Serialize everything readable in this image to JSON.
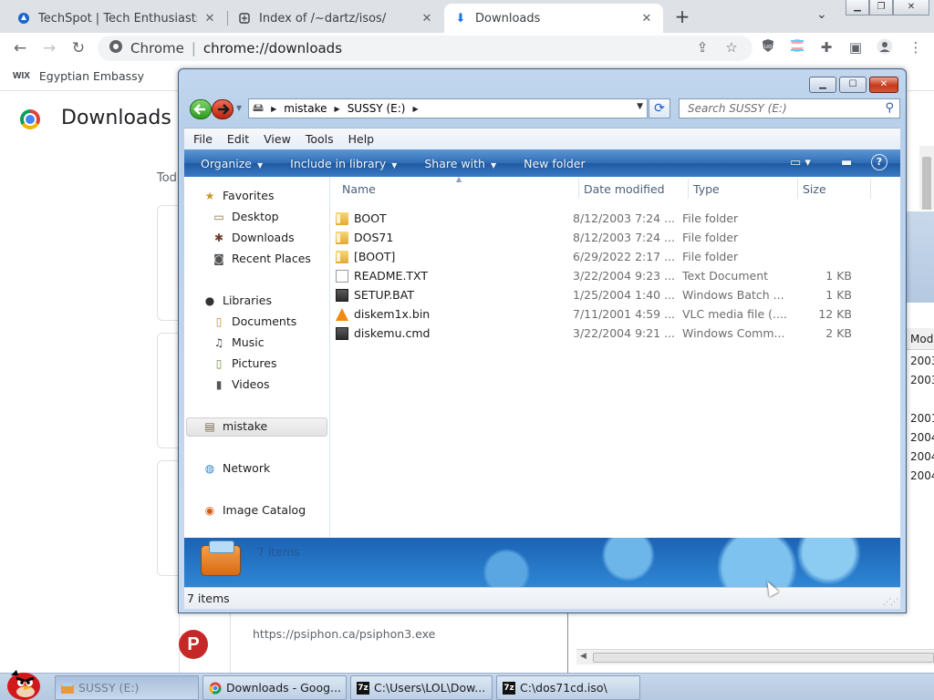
{
  "browser": {
    "tabs": [
      {
        "title": "TechSpot | Tech Enthusiasts, Po",
        "icon": "techspot-icon"
      },
      {
        "title": "Index of /~dartz/isos/",
        "icon": "globe-icon"
      },
      {
        "title": "Downloads",
        "icon": "download-icon",
        "active": true
      }
    ],
    "omnibox": {
      "site": "Chrome",
      "url": "chrome://downloads"
    },
    "bookmarks": [
      {
        "logo": "WIX",
        "label": "Egyptian Embassy"
      }
    ]
  },
  "downloads_page": {
    "title": "Downloads",
    "today_label": "Tod",
    "psiphon_url": "https://psiphon.ca/psiphon3.exe",
    "psiphon_letter": "P"
  },
  "background_window": {
    "column_header": "Mod",
    "values": [
      "2003",
      "2003",
      "2001",
      "2004",
      "2004",
      "2004"
    ]
  },
  "explorer": {
    "breadcrumb": [
      "mistake",
      "SUSSY (E:)"
    ],
    "search_placeholder": "Search SUSSY (E:)",
    "menu": [
      "File",
      "Edit",
      "View",
      "Tools",
      "Help"
    ],
    "commands": [
      {
        "label": "Organize",
        "has_dropdown": true
      },
      {
        "label": "Include in library",
        "has_dropdown": true
      },
      {
        "label": "Share with",
        "has_dropdown": true
      },
      {
        "label": "New folder",
        "has_dropdown": false
      }
    ],
    "nav": {
      "favorites_header": "Favorites",
      "favorites": [
        "Desktop",
        "Downloads",
        "Recent Places"
      ],
      "libraries_header": "Libraries",
      "libraries": [
        "Documents",
        "Music",
        "Pictures",
        "Videos"
      ],
      "selected": "mistake",
      "network": "Network",
      "image_catalog": "Image Catalog"
    },
    "columns": [
      "Name",
      "Date modified",
      "Type",
      "Size"
    ],
    "files": [
      {
        "name": "BOOT",
        "date": "8/12/2003 7:24 ...",
        "type": "File folder",
        "size": "",
        "icon": "folder"
      },
      {
        "name": "DOS71",
        "date": "8/12/2003 7:24 ...",
        "type": "File folder",
        "size": "",
        "icon": "folder"
      },
      {
        "name": "[BOOT]",
        "date": "6/29/2022 2:17 ...",
        "type": "File folder",
        "size": "",
        "icon": "folder"
      },
      {
        "name": "README.TXT",
        "date": "3/22/2004 9:23 ...",
        "type": "Text Document",
        "size": "1 KB",
        "icon": "text"
      },
      {
        "name": "SETUP.BAT",
        "date": "1/25/2004 1:40 ...",
        "type": "Windows Batch ...",
        "size": "1 KB",
        "icon": "batch"
      },
      {
        "name": "diskem1x.bin",
        "date": "7/11/2001 4:59 ...",
        "type": "VLC media file (....",
        "size": "12 KB",
        "icon": "vlc"
      },
      {
        "name": "diskemu.cmd",
        "date": "3/22/2004 9:21 ...",
        "type": "Windows Comm...",
        "size": "2 KB",
        "icon": "batch"
      }
    ],
    "details_count": "7 items",
    "status_count": "7 items"
  },
  "taskbar": {
    "items": [
      {
        "label": "SUSSY (E:)",
        "icon": "explorer-icon",
        "dim": true
      },
      {
        "label": "Downloads - Goog...",
        "icon": "chrome-icon",
        "dim": false
      },
      {
        "label": "C:\\Users\\LOL\\Dow...",
        "icon": "7zip-icon",
        "dim": false
      },
      {
        "label": "C:\\dos71cd.iso\\",
        "icon": "7zip-icon",
        "dim": false
      }
    ]
  }
}
